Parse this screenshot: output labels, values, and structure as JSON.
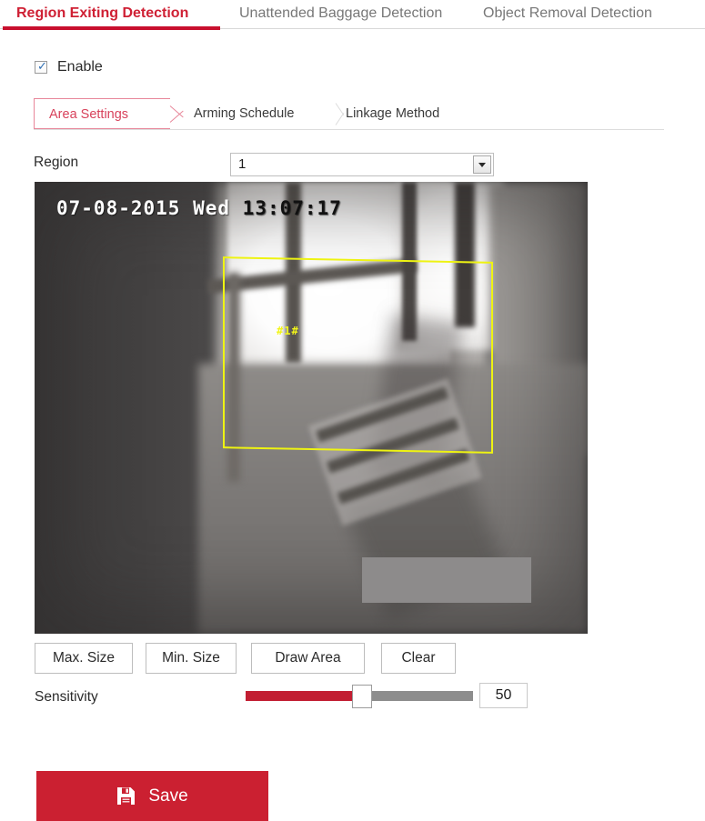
{
  "tabs": [
    {
      "label": "Region Exiting Detection",
      "active": true
    },
    {
      "label": "Unattended Baggage Detection",
      "active": false
    },
    {
      "label": "Object Removal Detection",
      "active": false
    }
  ],
  "enable": {
    "label": "Enable",
    "checked": true,
    "check_glyph": "✓"
  },
  "subtabs": [
    {
      "label": "Area Settings",
      "active": true
    },
    {
      "label": "Arming Schedule",
      "active": false
    },
    {
      "label": "Linkage Method",
      "active": false
    }
  ],
  "region": {
    "label": "Region",
    "value": "1"
  },
  "video": {
    "timestamp_date": "07-08-2015 Wed",
    "timestamp_time": "13:07:17",
    "region_label": "#1#",
    "region_outline_color": "#eef312"
  },
  "buttons": [
    {
      "label": "Max. Size"
    },
    {
      "label": "Min. Size"
    },
    {
      "label": "Draw Area"
    },
    {
      "label": "Clear"
    }
  ],
  "sensitivity": {
    "label": "Sensitivity",
    "value": "50",
    "fill_color": "#c21e32"
  },
  "save": {
    "label": "Save",
    "color": "#cb2031"
  }
}
